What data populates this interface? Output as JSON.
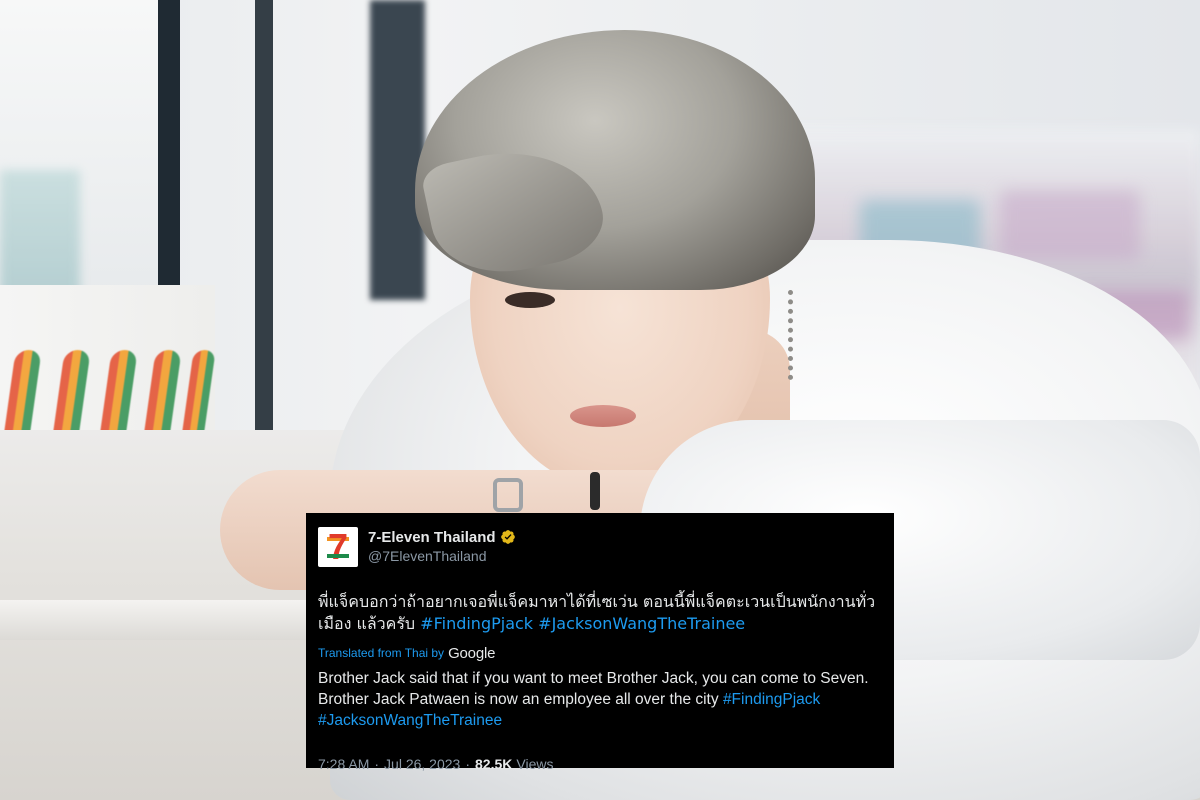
{
  "tweet": {
    "display_name": "7-Eleven Thailand",
    "handle": "@7ElevenThailand",
    "verified_icon": "verified-badge-gold-icon",
    "text_thai_plain": "พี่แจ็คบอกว่าถ้าอยากเจอพี่แจ็คมาหาได้ที่เซเว่น ตอนนี้พี่แจ็คตะเวนเป็นพนักงานทั่วเมือง แล้วครับ",
    "text_thai_hashtag_1": "#FindingPjack",
    "text_thai_hashtag_2": "#JacksonWangTheTrainee",
    "translated_from": "Translated from Thai by",
    "translator": "Google",
    "text_en_plain": "Brother Jack said that if you want to meet Brother Jack, you can come to Seven. Brother Jack Patwaen is now an employee all over the city",
    "text_en_hashtag_1": "#FindingPjack",
    "text_en_hashtag_2": "#JacksonWangTheTrainee",
    "time": "7:28 AM",
    "separator": "·",
    "date": "Jul 26, 2023",
    "views_count": "82.5K",
    "views_label": "Views"
  },
  "colors": {
    "card_bg": "#000000",
    "text": "#e7e9ea",
    "muted": "#8b98a5",
    "link": "#1d9bf0",
    "verified": "#e2b719",
    "brand_red": "#e03a2a",
    "brand_orange": "#f29222",
    "brand_green": "#1d8a4a"
  }
}
